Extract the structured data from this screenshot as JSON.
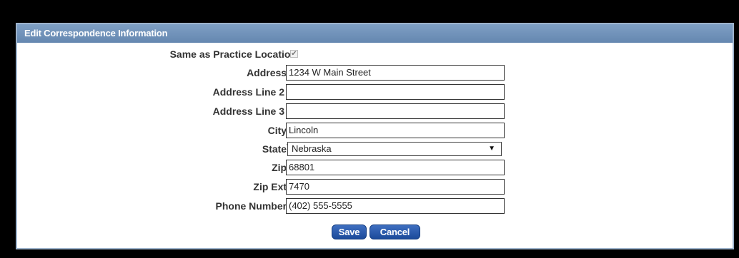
{
  "panel": {
    "title": "Edit Correspondence Information"
  },
  "fields": {
    "same_as_practice": {
      "label": "Same as Practice Location",
      "checked": true
    },
    "address": {
      "label": "Address",
      "required_mark": "*",
      "value": "1234 W Main Street"
    },
    "address2": {
      "label": "Address Line 2",
      "value": ""
    },
    "address3": {
      "label": "Address Line 3",
      "value": ""
    },
    "city": {
      "label": "City",
      "required_mark": "*",
      "value": "Lincoln"
    },
    "state": {
      "label": "State",
      "required_mark": "*",
      "value": "Nebraska"
    },
    "zip": {
      "label": "Zip",
      "required_mark": "*",
      "value": "68801"
    },
    "zip_ext": {
      "label": "Zip Ext",
      "required_mark": "*",
      "value": "7470"
    },
    "phone": {
      "label": "Phone Number",
      "required_mark": "*",
      "value": "(402) 555-5555"
    }
  },
  "buttons": {
    "save": "Save",
    "cancel": "Cancel"
  },
  "colors": {
    "header": "#6e90b8",
    "button": "#2a5aa8"
  }
}
